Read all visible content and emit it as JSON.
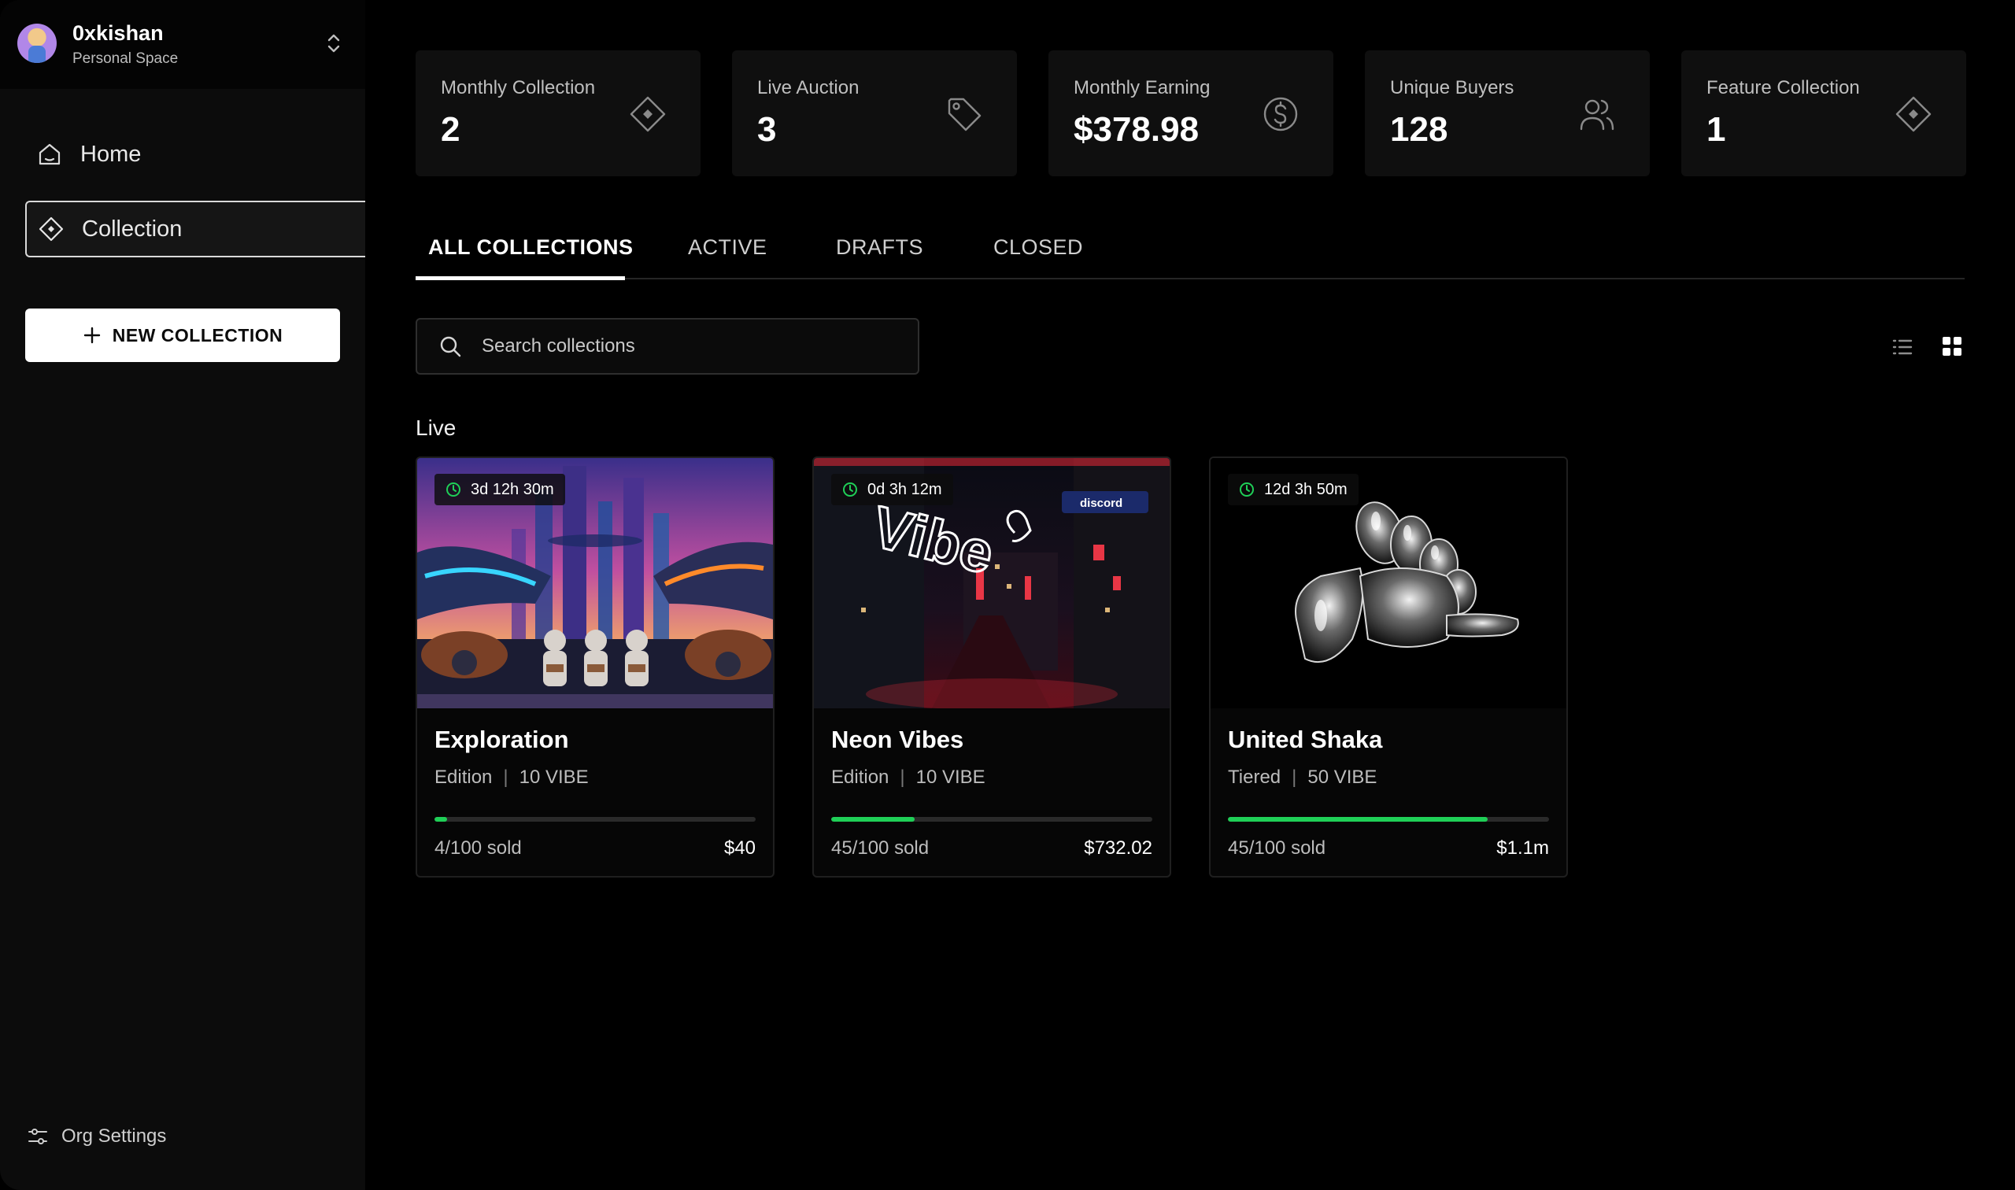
{
  "account": {
    "name": "0xkishan",
    "subtitle": "Personal Space"
  },
  "sidebar": {
    "items": [
      {
        "label": "Home",
        "icon": "home-icon"
      },
      {
        "label": "Collection",
        "icon": "diamond-icon",
        "active": true
      }
    ],
    "new_button": "NEW COLLECTION",
    "settings_label": "Org Settings"
  },
  "stats": [
    {
      "label": "Monthly Collection",
      "value": "2",
      "icon": "diamond-icon"
    },
    {
      "label": "Live Auction",
      "value": "3",
      "icon": "tag-icon"
    },
    {
      "label": "Monthly Earning",
      "value": "$378.98",
      "icon": "dollar-icon"
    },
    {
      "label": "Unique Buyers",
      "value": "128",
      "icon": "users-icon"
    },
    {
      "label": "Feature Collection",
      "value": "1",
      "icon": "diamond-icon"
    }
  ],
  "tabs": [
    "ALL COLLECTIONS",
    "ACTIVE",
    "DRAFTS",
    "CLOSED"
  ],
  "search": {
    "placeholder": "Search collections"
  },
  "section_title": "Live",
  "cards": [
    {
      "title": "Exploration",
      "type": "Edition",
      "price_per": "10 VIBE",
      "timer": "3d 12h 30m",
      "sold": "4/100 sold",
      "progress": 0.04,
      "total": "$40"
    },
    {
      "title": "Neon Vibes",
      "type": "Edition",
      "price_per": "10 VIBE",
      "timer": "0d 3h 12m",
      "sold": "45/100 sold",
      "progress": 0.26,
      "total": "$732.02"
    },
    {
      "title": "United Shaka",
      "type": "Tiered",
      "price_per": "50 VIBE",
      "timer": "12d 3h 50m",
      "sold": "45/100 sold",
      "progress": 0.81,
      "total": "$1.1m"
    }
  ],
  "colors": {
    "accent": "#1fcf57",
    "background": "#000000",
    "sidebar": "#0c0c0c"
  },
  "image_text": {
    "neon_sign": "Vibe",
    "billboard": "discord"
  }
}
